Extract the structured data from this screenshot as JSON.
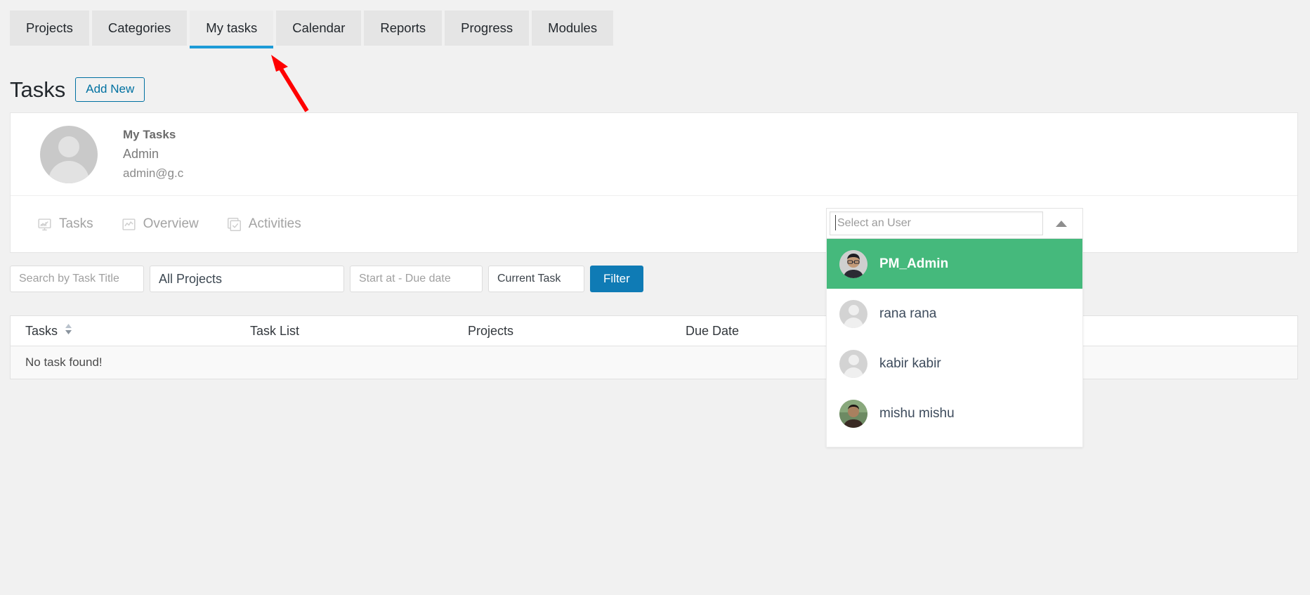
{
  "nav": {
    "tabs": [
      {
        "label": "Projects",
        "active": false
      },
      {
        "label": "Categories",
        "active": false
      },
      {
        "label": "My tasks",
        "active": true
      },
      {
        "label": "Calendar",
        "active": false
      },
      {
        "label": "Reports",
        "active": false
      },
      {
        "label": "Progress",
        "active": false
      },
      {
        "label": "Modules",
        "active": false
      }
    ],
    "active_accent": "#1e9bd7"
  },
  "header": {
    "title": "Tasks",
    "add_new_label": "Add New",
    "add_new_color": "#0071a1"
  },
  "annotation": {
    "arrow_color": "#ff0000"
  },
  "profile": {
    "heading": "My Tasks",
    "name": "Admin",
    "email": "admin@g.c"
  },
  "card_tabs": [
    {
      "label": "Tasks",
      "icon": "monitor-chart-icon"
    },
    {
      "label": "Overview",
      "icon": "line-chart-icon"
    },
    {
      "label": "Activities",
      "icon": "checkbox-icon"
    }
  ],
  "filters": {
    "search_placeholder": "Search by Task Title",
    "search_value": "",
    "project_value": "All Projects",
    "date_placeholder": "Start at - Due date",
    "date_value": "",
    "status_value": "Current Task",
    "filter_button": "Filter",
    "filter_button_color": "#0f7bb5"
  },
  "table": {
    "columns": [
      "Tasks",
      "Task List",
      "Projects",
      "Due Date"
    ],
    "sort_icon": "sort-updown-icon",
    "empty_message": "No task found!",
    "rows": []
  },
  "user_select": {
    "placeholder": "Select an User",
    "value": "",
    "caret_icon": "caret-up-icon",
    "selected_color": "#45b97c",
    "options": [
      {
        "name": "PM_Admin",
        "selected": true,
        "avatar": "photo"
      },
      {
        "name": "rana rana",
        "selected": false,
        "avatar": "generic"
      },
      {
        "name": "kabir kabir",
        "selected": false,
        "avatar": "generic"
      },
      {
        "name": "mishu mishu",
        "selected": false,
        "avatar": "photo"
      }
    ]
  }
}
